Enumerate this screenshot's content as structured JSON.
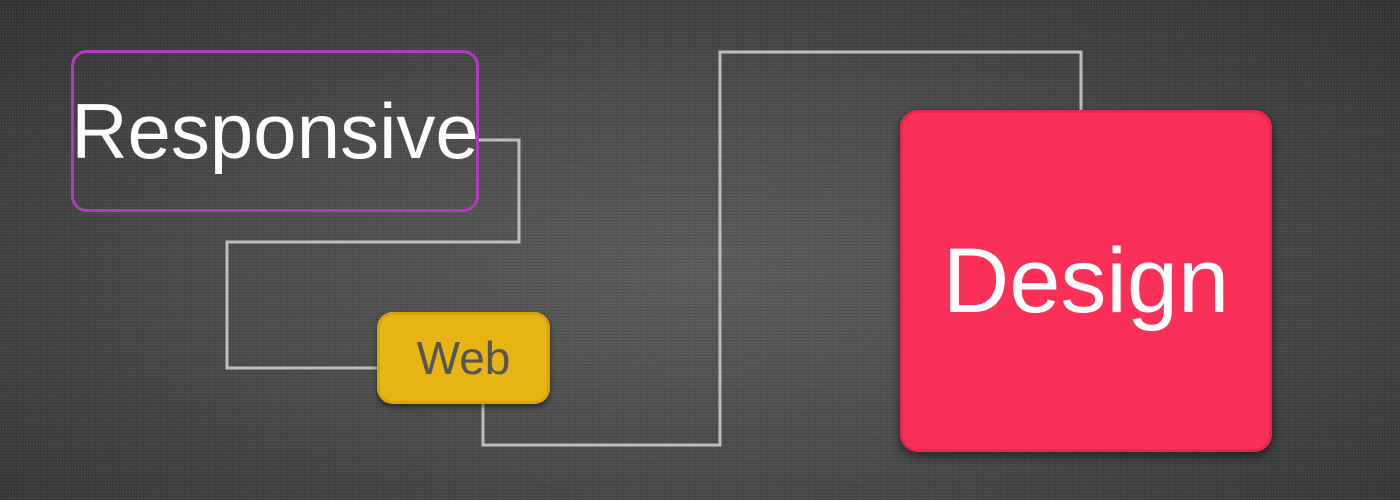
{
  "words": {
    "responsive": "Responsive",
    "web": "Web",
    "design": "Design"
  },
  "colors": {
    "responsive_border": "#b13bc0",
    "web_fill": "#e6b413",
    "design_fill": "#fb3059",
    "connector": "#bdbdbd"
  }
}
